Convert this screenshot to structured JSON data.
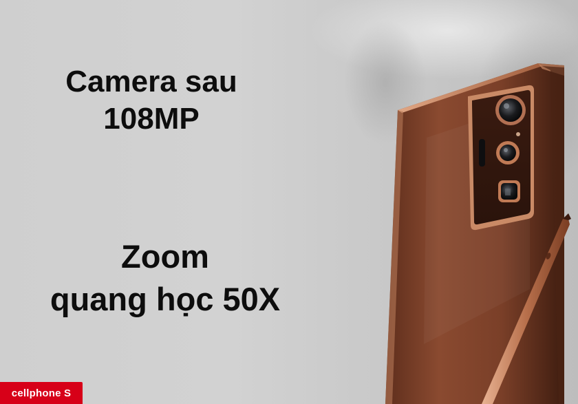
{
  "headline_camera": {
    "line1": "Camera sau",
    "line2": "108MP"
  },
  "headline_zoom": {
    "line1": "Zoom",
    "line2": "quang học 50X"
  },
  "brand": {
    "name": "cellphone S",
    "color": "#d70018"
  },
  "colors": {
    "background": "#cfcfcf",
    "phone_body": "#8a4a30",
    "phone_edge": "#c98a66",
    "text": "#0d0d0d"
  }
}
